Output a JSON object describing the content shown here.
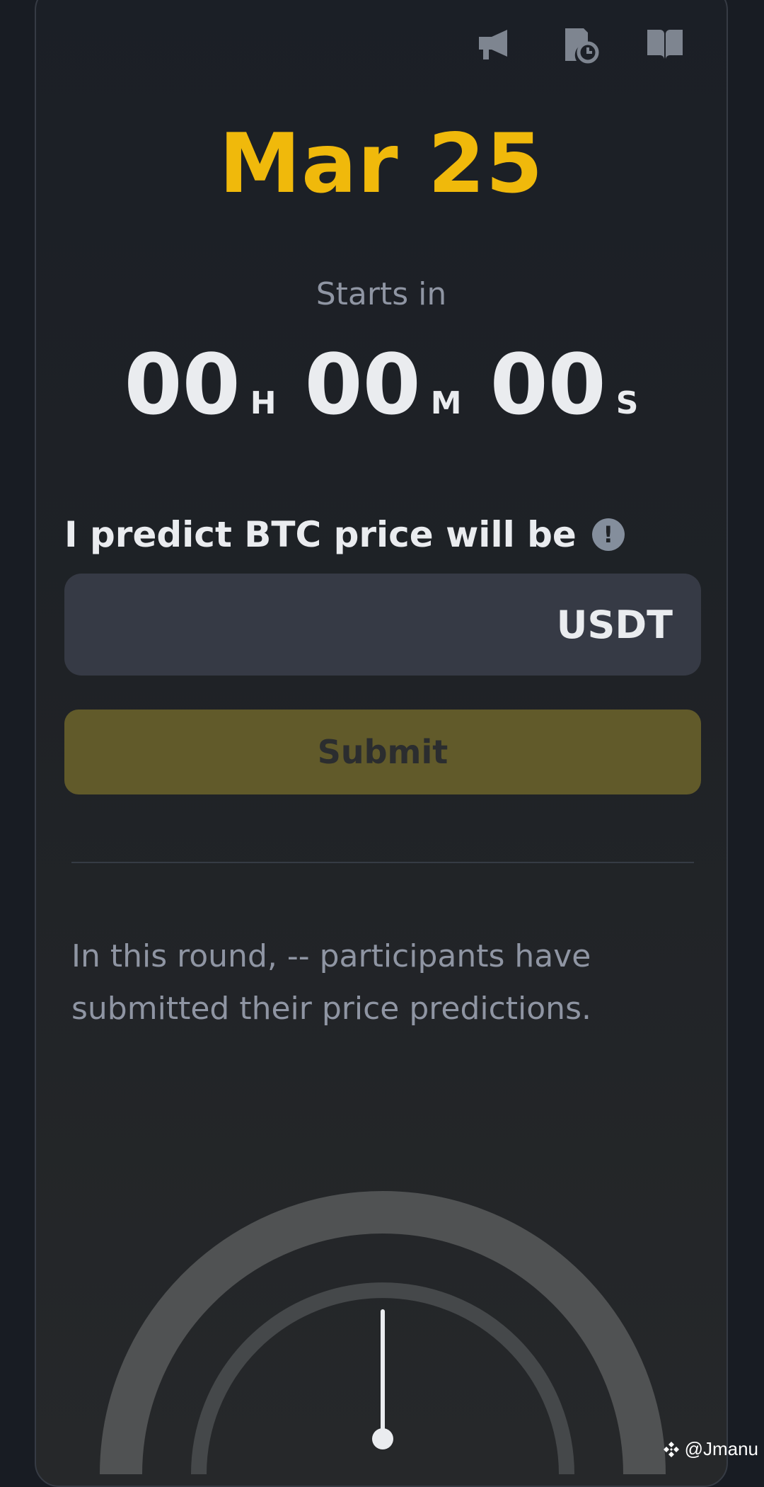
{
  "header": {
    "icons": [
      "megaphone-icon",
      "history-icon",
      "book-icon"
    ]
  },
  "round": {
    "date": "Mar 25",
    "starts_label": "Starts in",
    "countdown": {
      "hours": "00",
      "hours_unit": "H",
      "minutes": "00",
      "minutes_unit": "M",
      "seconds": "00",
      "seconds_unit": "S"
    }
  },
  "prediction": {
    "label": "I predict BTC price will be",
    "info_glyph": "!",
    "input_value": "",
    "currency": "USDT",
    "submit_label": "Submit"
  },
  "stats": {
    "participants_text": "In this round, -- participants have submitted their price predictions."
  },
  "gauge": {
    "needle_fraction": 0.5
  },
  "watermark": {
    "text": "@Jmanu"
  },
  "colors": {
    "accent": "#f0b90b",
    "background": "#181c23",
    "input_bg": "#363a45",
    "submit_disabled": "#615a2a"
  }
}
